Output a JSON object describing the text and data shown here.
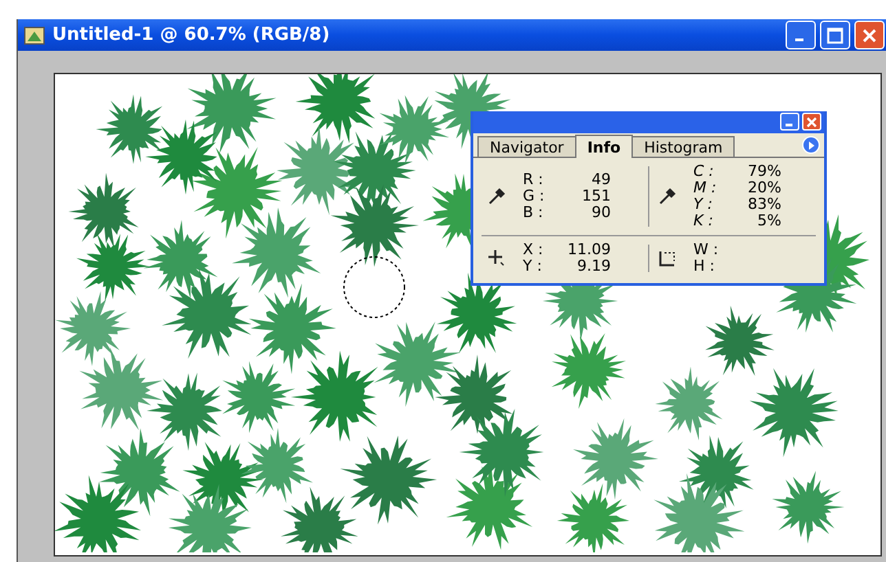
{
  "window": {
    "title": "Untitled-1 @ 60.7% (RGB/8)"
  },
  "info_panel": {
    "tabs": [
      {
        "label": "Navigator",
        "selected": false
      },
      {
        "label": "Info",
        "selected": true
      },
      {
        "label": "Histogram",
        "selected": false
      }
    ],
    "rgb": [
      {
        "label": "R :",
        "value": "49"
      },
      {
        "label": "G :",
        "value": "151"
      },
      {
        "label": "B :",
        "value": "90"
      }
    ],
    "cmyk": [
      {
        "label": "C :",
        "value": "79%"
      },
      {
        "label": "M :",
        "value": "20%"
      },
      {
        "label": "Y :",
        "value": "83%"
      },
      {
        "label": "K :",
        "value": "5%"
      }
    ],
    "position": [
      {
        "label": "X :",
        "value": "11.09"
      },
      {
        "label": "Y :",
        "value": "9.19"
      }
    ],
    "size": [
      {
        "label": "W :"
      },
      {
        "label": "H :"
      }
    ]
  }
}
